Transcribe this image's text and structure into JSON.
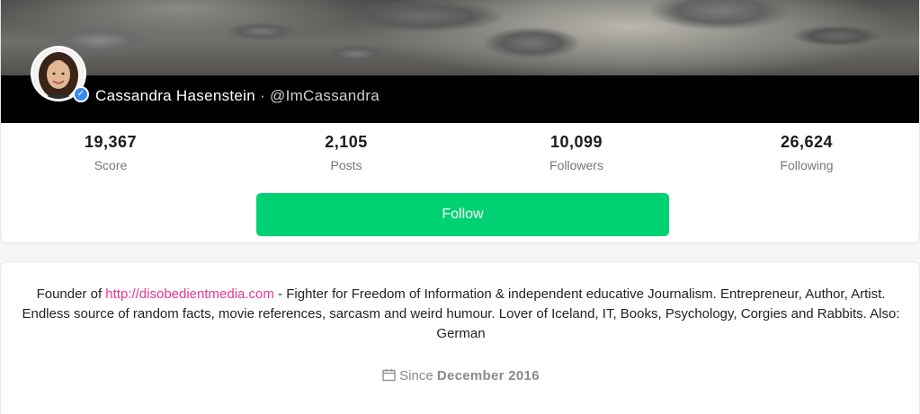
{
  "profile": {
    "display_name": "Cassandra Hasenstein",
    "separator": "·",
    "handle": "@ImCassandra",
    "verified_icon": "verified-check-icon"
  },
  "stats": [
    {
      "value": "19,367",
      "label": "Score"
    },
    {
      "value": "2,105",
      "label": "Posts"
    },
    {
      "value": "10,099",
      "label": "Followers"
    },
    {
      "value": "26,624",
      "label": "Following"
    }
  ],
  "follow": {
    "label": "Follow",
    "color": "#00d172"
  },
  "bio": {
    "prefix": "Founder of ",
    "link": "http://disobedientmedia.com",
    "suffix": " - Fighter for Freedom of Information & independent educative Journalism. Entrepreneur, Author, Artist. Endless source of random facts, movie references, sarcasm and weird humour. Lover of Iceland, IT, Books, Psychology, Corgies and Rabbits. Also: German",
    "link_color": "#e8368f"
  },
  "since": {
    "prefix": "Since",
    "date": "December 2016",
    "icon": "calendar-icon"
  }
}
